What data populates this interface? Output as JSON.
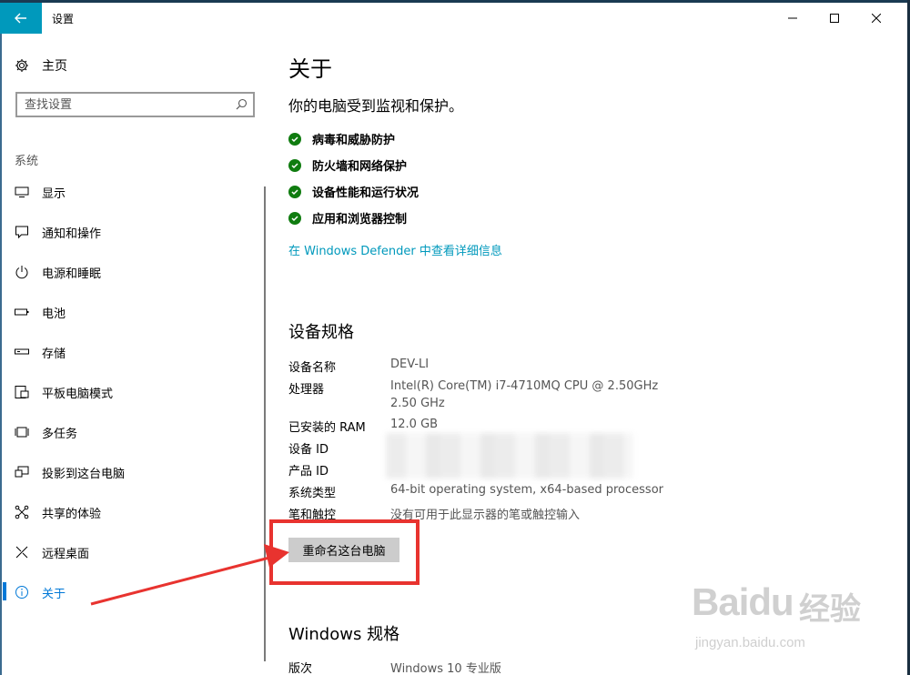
{
  "window": {
    "title": "设置",
    "back_icon": "back-arrow-icon",
    "controls": [
      "minimize",
      "maximize",
      "close"
    ]
  },
  "sidebar": {
    "home_label": "主页",
    "search_placeholder": "查找设置",
    "section_title": "系统",
    "items": [
      {
        "label": "显示",
        "icon": "display-icon"
      },
      {
        "label": "通知和操作",
        "icon": "notification-icon"
      },
      {
        "label": "电源和睡眠",
        "icon": "power-icon"
      },
      {
        "label": "电池",
        "icon": "battery-icon"
      },
      {
        "label": "存储",
        "icon": "storage-icon"
      },
      {
        "label": "平板电脑模式",
        "icon": "tablet-mode-icon"
      },
      {
        "label": "多任务",
        "icon": "multitasking-icon"
      },
      {
        "label": "投影到这台电脑",
        "icon": "projecting-icon"
      },
      {
        "label": "共享的体验",
        "icon": "shared-experiences-icon"
      },
      {
        "label": "远程桌面",
        "icon": "remote-desktop-icon"
      },
      {
        "label": "关于",
        "icon": "info-icon",
        "active": true
      }
    ]
  },
  "main": {
    "title": "关于",
    "protection_message": "你的电脑受到监视和保护。",
    "protections": [
      "病毒和威胁防护",
      "防火墙和网络保护",
      "设备性能和运行状况",
      "应用和浏览器控制"
    ],
    "defender_link": "在 Windows Defender 中查看详细信息",
    "device_specs_title": "设备规格",
    "device_specs": {
      "device_name_label": "设备名称",
      "device_name": "DEV-LI",
      "processor_label": "处理器",
      "processor_line1": "Intel(R) Core(TM) i7-4710MQ CPU @ 2.50GHz",
      "processor_line2": "2.50 GHz",
      "ram_label": "已安装的 RAM",
      "ram": "12.0 GB",
      "device_id_label": "设备 ID",
      "product_id_label": "产品 ID",
      "system_type_label": "系统类型",
      "system_type": "64-bit operating system, x64-based processor",
      "pen_touch_label": "笔和触控",
      "pen_touch": "没有可用于此显示器的笔或触控输入"
    },
    "rename_button": "重命名这台电脑",
    "windows_specs_title": "Windows 规格",
    "edition_label": "版次",
    "edition": "Windows 10 专业版"
  },
  "watermark": {
    "brand": "Baidu",
    "brand_cn": "经验",
    "url": "jingyan.baidu.com"
  },
  "colors": {
    "accent": "#0099bc",
    "active_nav": "#0078d7",
    "check_green": "#107c10",
    "annotation_red": "#e8332f"
  }
}
